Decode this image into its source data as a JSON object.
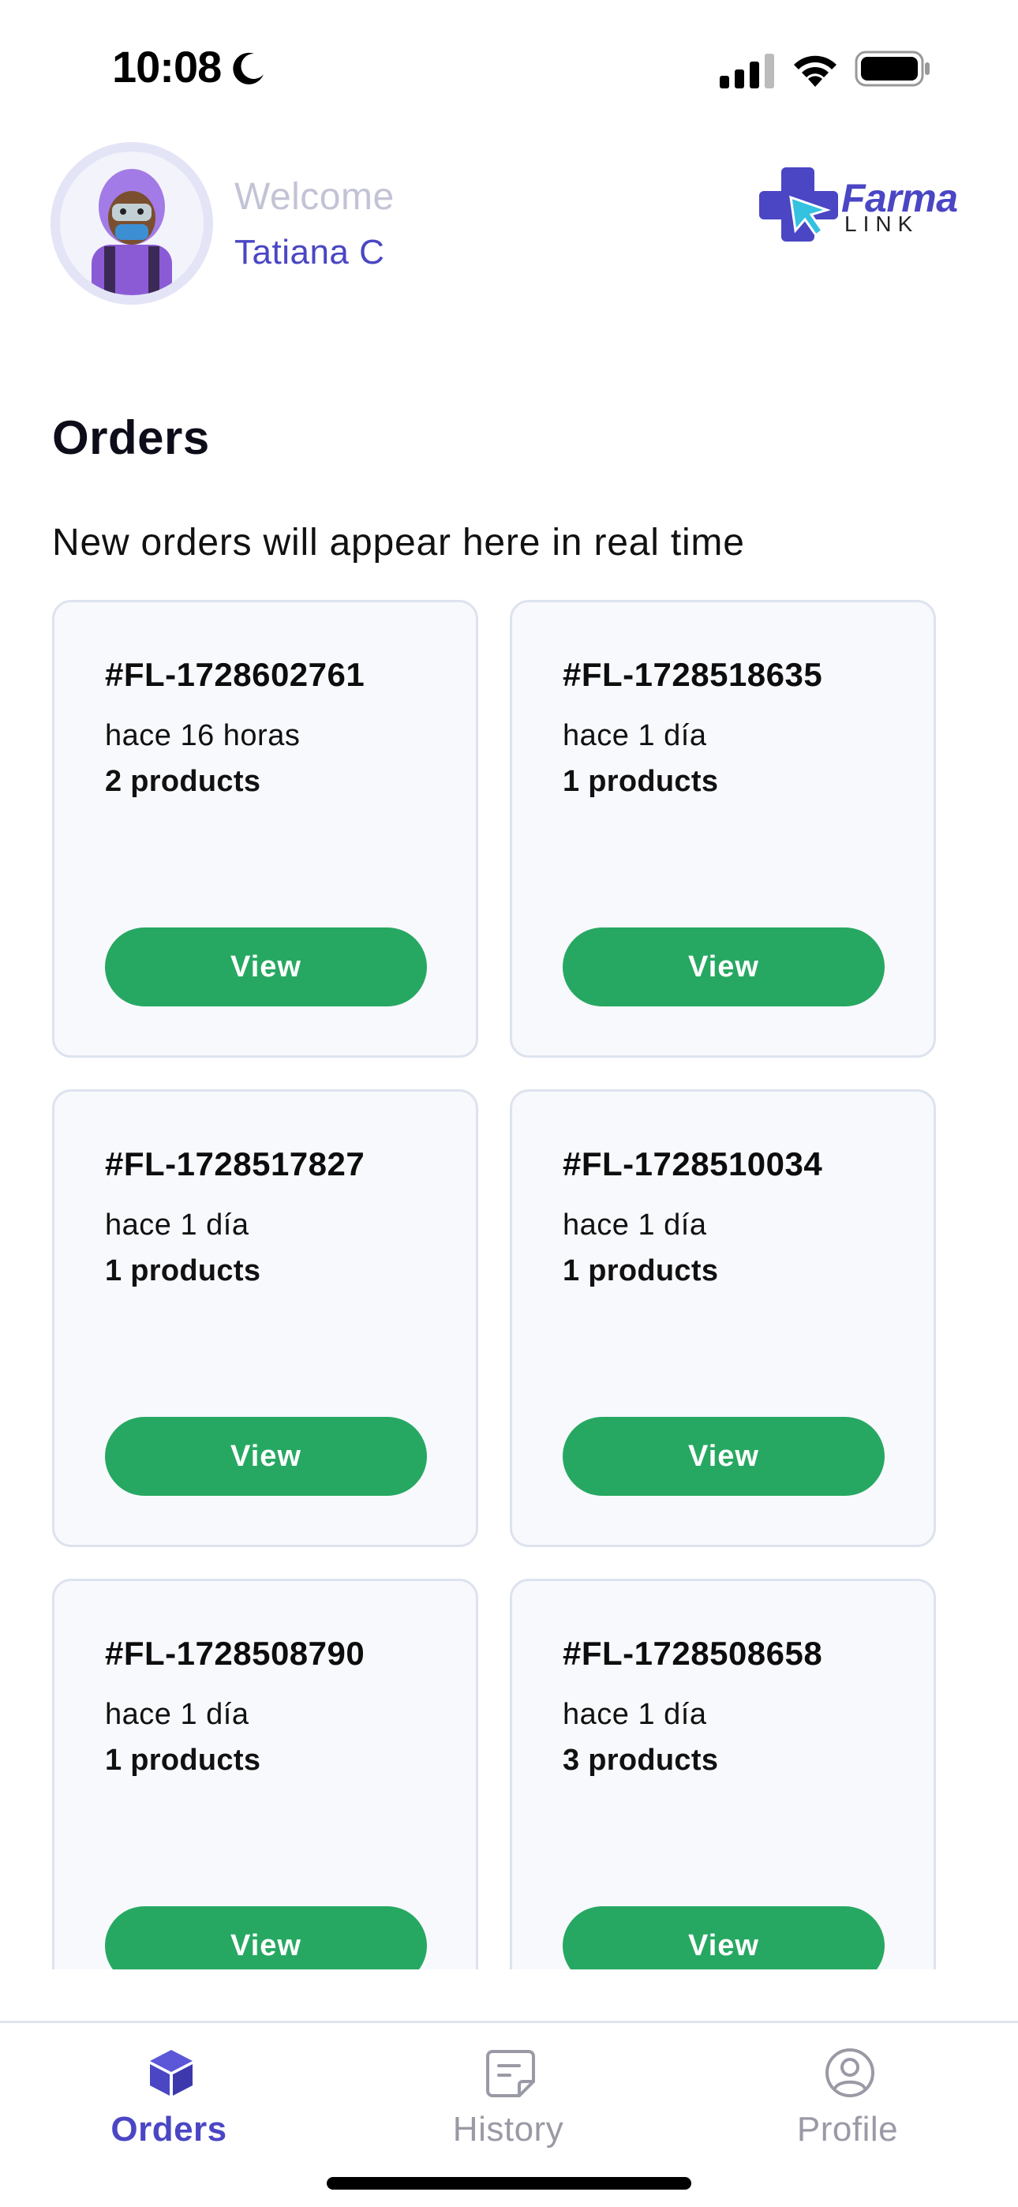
{
  "status_bar": {
    "time": "10:08",
    "icons": [
      "moon-icon",
      "cellular-signal-icon",
      "wifi-icon",
      "battery-icon"
    ]
  },
  "header": {
    "welcome": "Welcome",
    "user_name": "Tatiana C",
    "logo": {
      "word": "Farma",
      "sub": "LINK"
    }
  },
  "orders_section": {
    "title": "Orders",
    "subtitle": "New orders will appear here in real time"
  },
  "orders": [
    {
      "id": "#FL-1728602761",
      "time": "hace 16 horas",
      "products": "2 products",
      "button": "View"
    },
    {
      "id": "#FL-1728518635",
      "time": "hace 1 día",
      "products": "1 products",
      "button": "View"
    },
    {
      "id": "#FL-1728517827",
      "time": "hace 1 día",
      "products": "1 products",
      "button": "View"
    },
    {
      "id": "#FL-1728510034",
      "time": "hace 1 día",
      "products": "1 products",
      "button": "View"
    },
    {
      "id": "#FL-1728508790",
      "time": "hace 1 día",
      "products": "1 products",
      "button": "View"
    },
    {
      "id": "#FL-1728508658",
      "time": "hace 1 día",
      "products": "3 products",
      "button": "View"
    }
  ],
  "bottom_nav": {
    "items": [
      {
        "label": "Orders",
        "icon": "box-icon",
        "active": true
      },
      {
        "label": "History",
        "icon": "document-icon",
        "active": false
      },
      {
        "label": "Profile",
        "icon": "user-circle-icon",
        "active": false
      }
    ]
  },
  "colors": {
    "accent": "#4a46c4",
    "button_green": "#27a862",
    "card_bg": "#f8f9fd",
    "card_border": "#dde3ee",
    "muted": "#9a9aa6"
  }
}
